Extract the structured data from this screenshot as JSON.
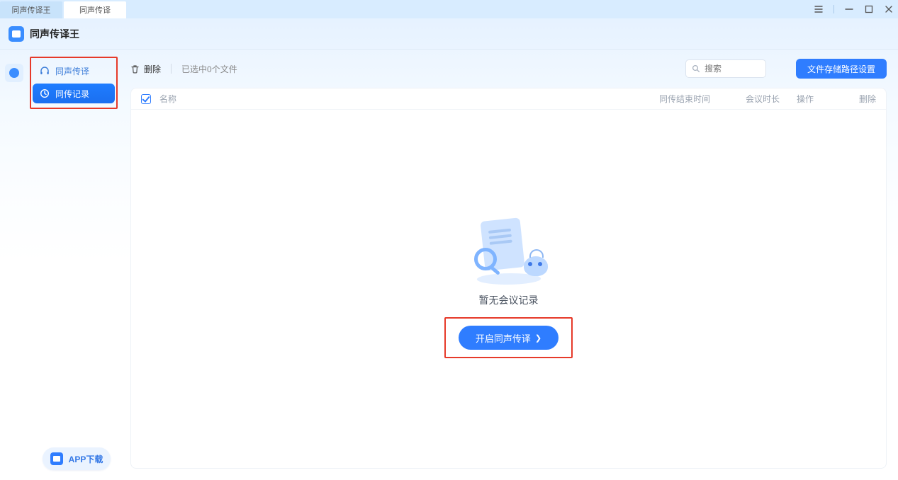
{
  "window": {
    "tabs": [
      {
        "label": "同声传译王",
        "active": false
      },
      {
        "label": "同声传译",
        "active": true
      }
    ]
  },
  "app": {
    "title": "同声传译王"
  },
  "sidebar": {
    "items": [
      {
        "id": "live",
        "label": "同声传译",
        "icon": "headphones-icon",
        "active": false
      },
      {
        "id": "records",
        "label": "同传记录",
        "icon": "clock-icon",
        "active": true
      }
    ]
  },
  "app_download": {
    "label": "APP下载"
  },
  "toolbar": {
    "delete_label": "删除",
    "selected_text": "已选中0个文件",
    "search_placeholder": "搜索",
    "path_button": "文件存储路径设置"
  },
  "columns": {
    "name": "名称",
    "end_time": "同传结束时间",
    "duration": "会议时长",
    "operation": "操作",
    "delete": "删除"
  },
  "empty": {
    "text": "暂无会议记录",
    "start_button": "开启同声传译"
  },
  "colors": {
    "primary": "#2f7dff",
    "highlight_border": "#e63a2a"
  }
}
